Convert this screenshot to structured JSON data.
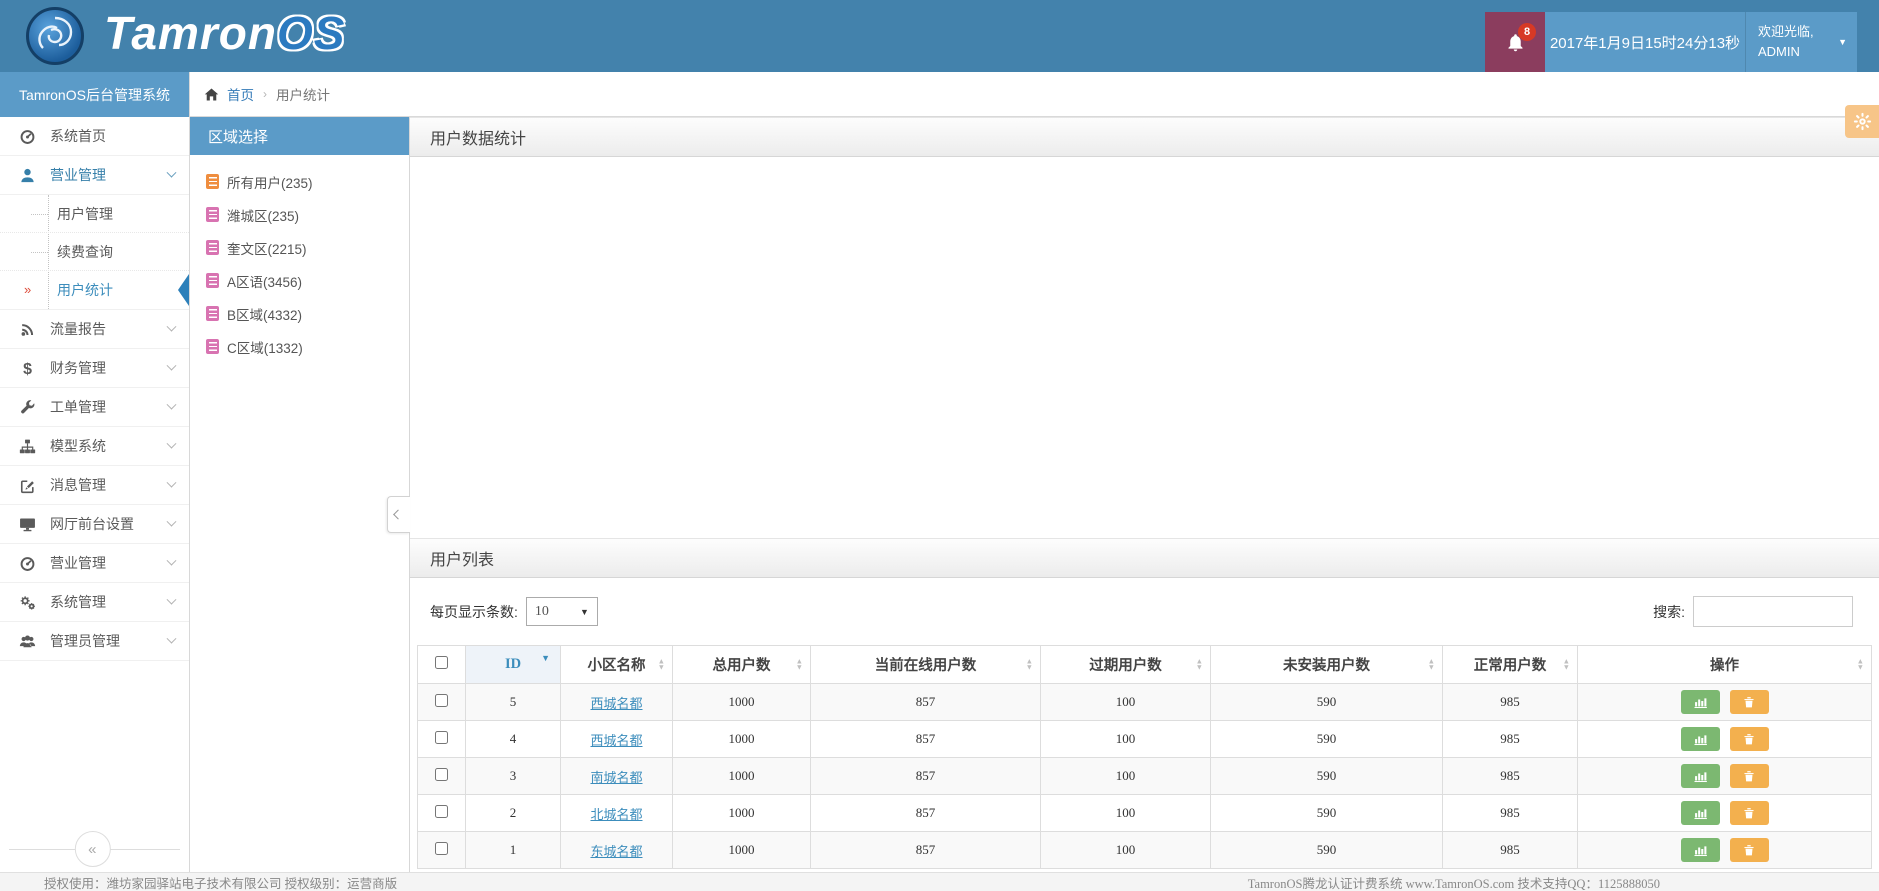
{
  "header": {
    "logo_text_primary": "Tamron",
    "logo_text_secondary": "OS",
    "notification_count": "8",
    "datetime": "2017年1月9日15时24分13秒",
    "welcome_line1": "欢迎光临,",
    "welcome_line2": "ADMIN"
  },
  "sidebar": {
    "title": "TamronOS后台管理系统",
    "items": [
      {
        "icon": "dashboard-icon",
        "label": "系统首页"
      },
      {
        "icon": "user-icon",
        "label": "营业管理",
        "active": true,
        "expanded": true
      },
      {
        "icon": "rss-icon",
        "label": "流量报告"
      },
      {
        "icon": "dollar-icon",
        "label": "财务管理"
      },
      {
        "icon": "wrench-icon",
        "label": "工单管理"
      },
      {
        "icon": "sitemap-icon",
        "label": "模型系统"
      },
      {
        "icon": "edit-icon",
        "label": "消息管理"
      },
      {
        "icon": "desktop-icon",
        "label": "网厅前台设置"
      },
      {
        "icon": "dashboard-icon",
        "label": "营业管理"
      },
      {
        "icon": "cogs-icon",
        "label": "系统管理"
      },
      {
        "icon": "users-icon",
        "label": "管理员管理"
      }
    ],
    "submenu": [
      {
        "label": "用户管理"
      },
      {
        "label": "续费查询"
      },
      {
        "label": "用户统计",
        "active": true
      }
    ]
  },
  "breadcrumb": {
    "home": "首页",
    "separator": "›",
    "current": "用户统计"
  },
  "region_panel": {
    "title": "区域选择",
    "items": [
      {
        "label": "所有用户(235)",
        "icon": "list-icon",
        "icon_color": "#ef8d3e"
      },
      {
        "label": "潍城区(235)",
        "icon": "list-icon",
        "icon_color": "#d873b1"
      },
      {
        "label": "奎文区(2215)",
        "icon": "list-icon",
        "icon_color": "#d873b1"
      },
      {
        "label": "A区语(3456)",
        "icon": "list-icon",
        "icon_color": "#d873b1"
      },
      {
        "label": "B区域(4332)",
        "icon": "list-icon",
        "icon_color": "#d873b1"
      },
      {
        "label": "C区域(1332)",
        "icon": "list-icon",
        "icon_color": "#d873b1"
      }
    ]
  },
  "stats_panel": {
    "title": "用户数据统计"
  },
  "list_panel": {
    "title": "用户列表",
    "page_size_label": "每页显示条数:",
    "page_size_value": "10",
    "search_label": "搜索:",
    "table": {
      "columns": [
        "ID",
        "小区名称",
        "总用户数",
        "当前在线用户数",
        "过期用户数",
        "未安装用户数",
        "正常用户数",
        "操作"
      ],
      "sorted_column": "ID",
      "sort_direction": "desc",
      "rows": [
        {
          "id": "5",
          "name": "西城名都",
          "total": "1000",
          "online": "857",
          "expired": "100",
          "uninstalled": "590",
          "normal": "985"
        },
        {
          "id": "4",
          "name": "西城名都",
          "total": "1000",
          "online": "857",
          "expired": "100",
          "uninstalled": "590",
          "normal": "985"
        },
        {
          "id": "3",
          "name": "南城名都",
          "total": "1000",
          "online": "857",
          "expired": "100",
          "uninstalled": "590",
          "normal": "985"
        },
        {
          "id": "2",
          "name": "北城名都",
          "total": "1000",
          "online": "857",
          "expired": "100",
          "uninstalled": "590",
          "normal": "985"
        },
        {
          "id": "1",
          "name": "东城名都",
          "total": "1000",
          "online": "857",
          "expired": "100",
          "uninstalled": "590",
          "normal": "985"
        }
      ]
    }
  },
  "footer": {
    "left": "授权使用：潍坊家园驿站电子技术有限公司  授权级别：运营商版",
    "right": "TamronOS腾龙认证计费系统 www.TamronOS.com 技术支持QQ：1125888050"
  },
  "colors": {
    "header_blue": "#4382ac",
    "light_blue": "#5b9bc8",
    "notification_maroon": "#8b3d5e",
    "badge_red": "#d73925",
    "active_blue": "#3c8dbc",
    "submenu_marker_red": "#dd4b39",
    "active_arrow_blue": "#2d80ba",
    "gear_orange": "#f7c588",
    "button_green": "#7cb871",
    "button_orange": "#f3b04e",
    "region_icon_orange": "#ef8d3e",
    "region_icon_pink": "#d873b1"
  }
}
